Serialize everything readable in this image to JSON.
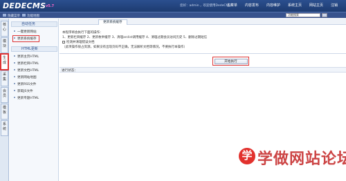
{
  "header": {
    "logo": "DEDECMS",
    "version": "v5.7",
    "welcome": "您好：admin ，欢迎使用DedeCMS！",
    "nav": [
      "主菜单",
      "内容发布",
      "内容维护",
      "系统主页",
      "网站主页",
      "注销"
    ]
  },
  "subbar": {
    "hide_menu": "隐藏菜单",
    "feature_map": "功能地图",
    "search_placeholder": "功能搜索"
  },
  "vtabs": [
    "核心",
    "模块",
    "生成",
    "采集",
    "会员",
    "模板",
    "系统"
  ],
  "menu": {
    "group1": {
      "title": "自动任务",
      "items": [
        "一键更新网站",
        "更新系统缓存"
      ]
    },
    "group2": {
      "title": "HTML更新",
      "items": [
        "更新主页HTML",
        "更新栏目HTML",
        "更新文档HTML",
        "更新网站地图",
        "更新RSS文件",
        "获取JS文件",
        "更新专题HTML"
      ]
    }
  },
  "main": {
    "tab": "更新系统缓存",
    "line1": "本程序将会执行下面的操作：",
    "line2": "1、更新栏目缓存 2、更新枚举缓存 3、清理arclist调用缓存 4、清理过期会员访问历史 5、删除过期短信",
    "checkbox_label": "检测并清理错误文档",
    "line3": "（此项操作很占资源，如果没有出现页码不正确，无法解析文档等情况，不要执行本操作）",
    "run_button": "开始执行",
    "status_label": "进行状态："
  },
  "watermark": {
    "badge": "学",
    "text": "学做网站论坛"
  },
  "colors": {
    "header_bg": "#1d3b70",
    "highlight": "#dd3333"
  }
}
